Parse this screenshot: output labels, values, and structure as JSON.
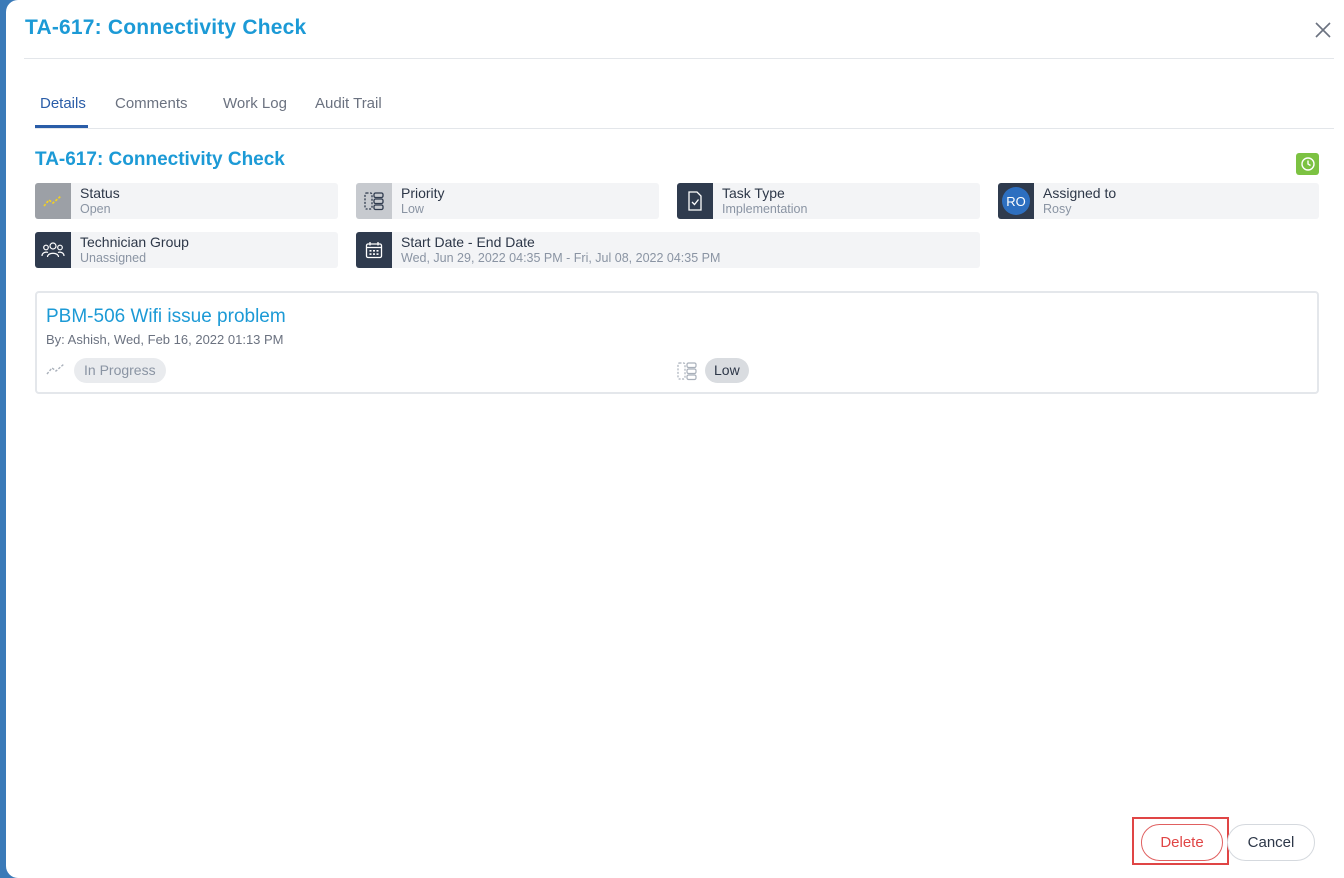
{
  "modal": {
    "title": "TA-617: Connectivity Check"
  },
  "tabs": [
    {
      "label": "Details",
      "active": true
    },
    {
      "label": "Comments",
      "active": false
    },
    {
      "label": "Work Log",
      "active": false
    },
    {
      "label": "Audit Trail",
      "active": false
    }
  ],
  "task": {
    "title": "TA-617: Connectivity Check",
    "fields": {
      "status": {
        "label": "Status",
        "value": "Open",
        "icon": "trend-icon"
      },
      "priority": {
        "label": "Priority",
        "value": "Low",
        "icon": "priority-icon"
      },
      "task_type": {
        "label": "Task Type",
        "value": "Implementation",
        "icon": "checklist-doc-icon"
      },
      "assigned_to": {
        "label": "Assigned to",
        "value": "Rosy",
        "avatar_initials": "RO"
      },
      "technician_group": {
        "label": "Technician Group",
        "value": "Unassigned",
        "icon": "group-icon"
      },
      "dates": {
        "label": "Start Date - End Date",
        "value": "Wed, Jun 29, 2022 04:35 PM - Fri, Jul 08, 2022 04:35 PM",
        "icon": "calendar-icon"
      }
    }
  },
  "linked_item": {
    "title": "PBM-506 Wifi issue problem",
    "meta": "By: Ashish, Wed, Feb 16, 2022 01:13 PM",
    "status": "In Progress",
    "priority": "Low"
  },
  "footer": {
    "delete_label": "Delete",
    "cancel_label": "Cancel"
  },
  "colors": {
    "accent": "#1c9ad6",
    "tab_active": "#2a5da8",
    "danger": "#e04545",
    "timer_green": "#7cc242"
  }
}
